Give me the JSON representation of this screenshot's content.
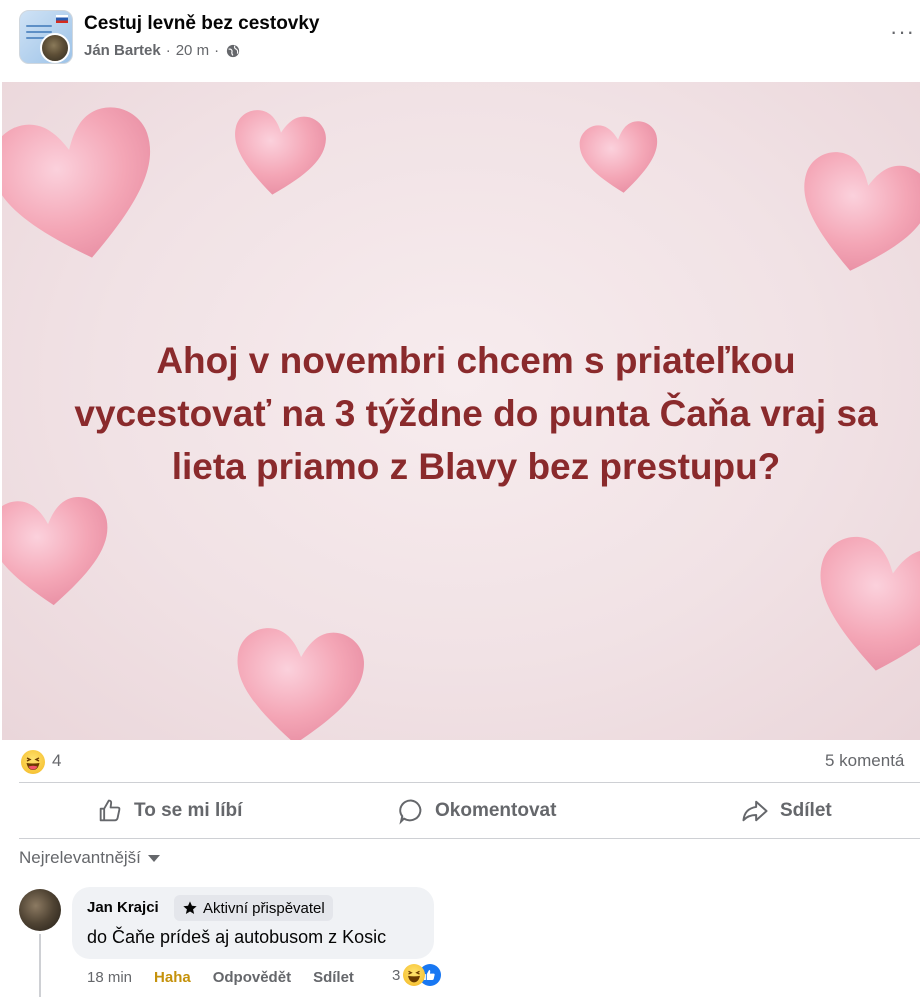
{
  "header": {
    "group_name": "Cestuj levně bez cestovky",
    "author": "Ján Bartek",
    "time": "20 m",
    "separator": "·"
  },
  "post": {
    "lines": [
      "Ahoj v novembri chcem s priateľkou",
      "vycestovať na 3 týždne do punta Čaňa vraj sa",
      "lieta priamo z Blavy bez prestupu?"
    ],
    "text_color": "#8a2a2c"
  },
  "summary": {
    "reaction_count": "4",
    "comments": "5 komentá"
  },
  "actions": {
    "like": "To se mi líbí",
    "comment": "Okomentovat",
    "share": "Sdílet"
  },
  "comments": {
    "sort_label": "Nejrelevantnější",
    "items": [
      {
        "author": "Jan Krajci",
        "badge": "Aktivní přispěvatel",
        "text": "do Čaňe prídeš aj autobusom z Kosic",
        "time": "18 min",
        "reaction_label": "Haha",
        "reply": "Odpovědět",
        "share": "Sdílet",
        "reaction_count": "3"
      }
    ]
  },
  "colors": {
    "secondary_text": "#65676b",
    "bubble": "#f0f2f5",
    "haha": "#c5920c",
    "heart": "#f4a6b6"
  }
}
